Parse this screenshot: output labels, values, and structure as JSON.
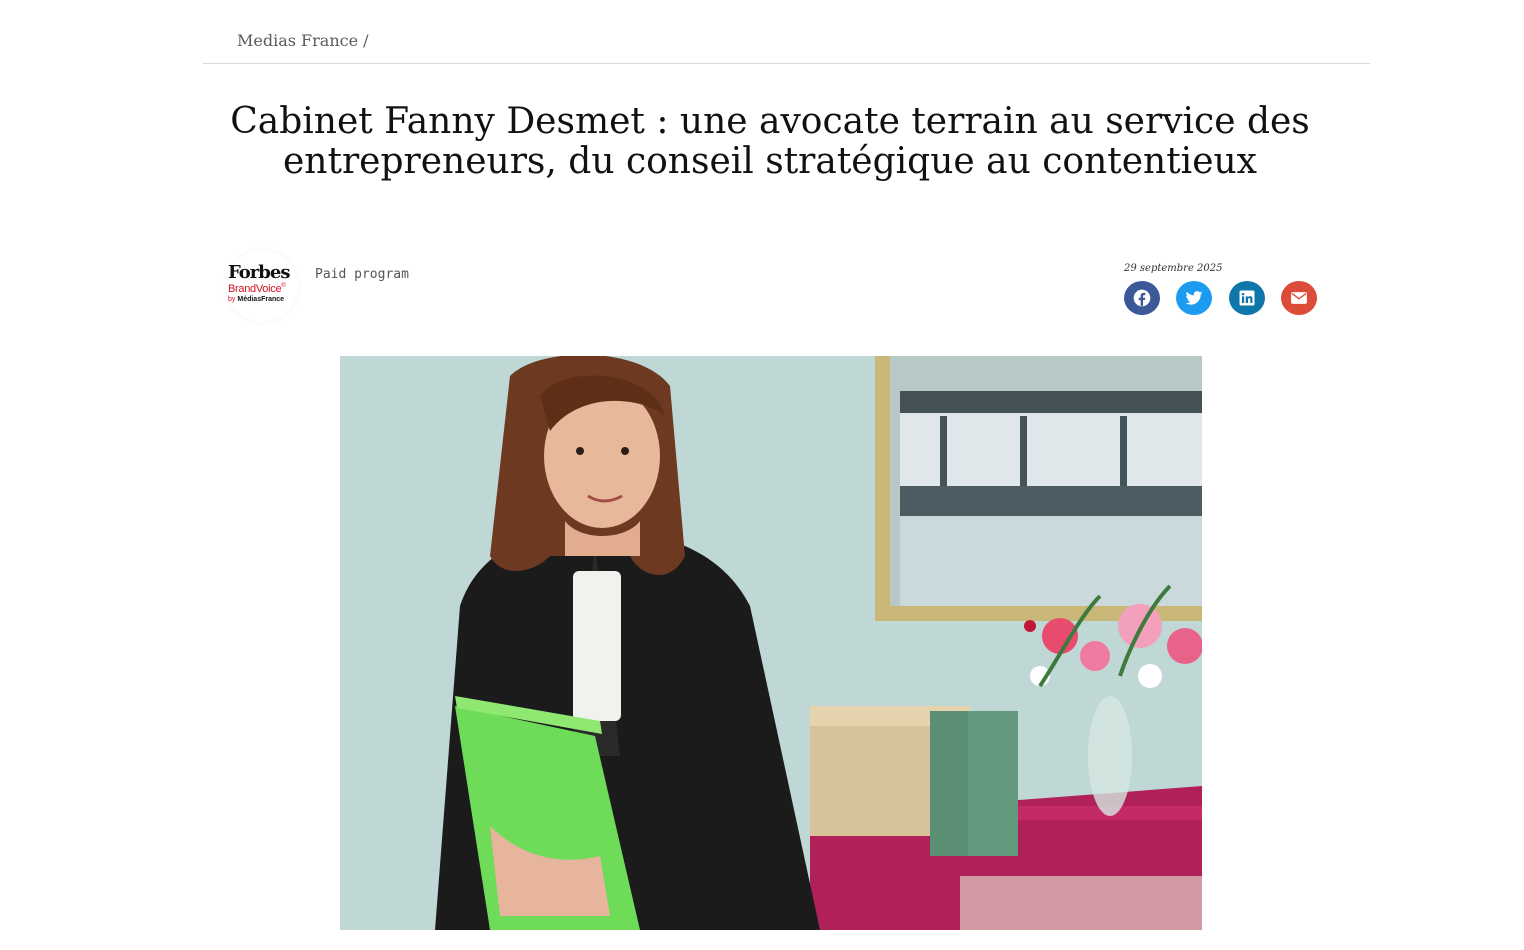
{
  "breadcrumb": {
    "label": "Medias France",
    "separator": "/"
  },
  "article": {
    "title": "Cabinet Fanny Desmet : une avocate terrain au service des entrepreneurs, du conseil stratégique au contentieux",
    "date": "29 septembre 2025",
    "sponsor_label": "Paid program"
  },
  "brand": {
    "forbes": "Forbes",
    "brandvoice": "BrandVoice",
    "registered": "®",
    "by": "by",
    "publisher": "MédiasFrance"
  },
  "share": [
    {
      "name": "facebook",
      "icon": "facebook-icon",
      "color": "#3b5998"
    },
    {
      "name": "twitter",
      "icon": "twitter-icon",
      "color": "#1d9bf0"
    },
    {
      "name": "linkedin",
      "icon": "linkedin-icon",
      "color": "#0e76a8"
    },
    {
      "name": "email",
      "icon": "envelope-icon",
      "color": "#dd4b39"
    }
  ],
  "hero_image": {
    "subject": "lawyer-portrait-photo"
  }
}
